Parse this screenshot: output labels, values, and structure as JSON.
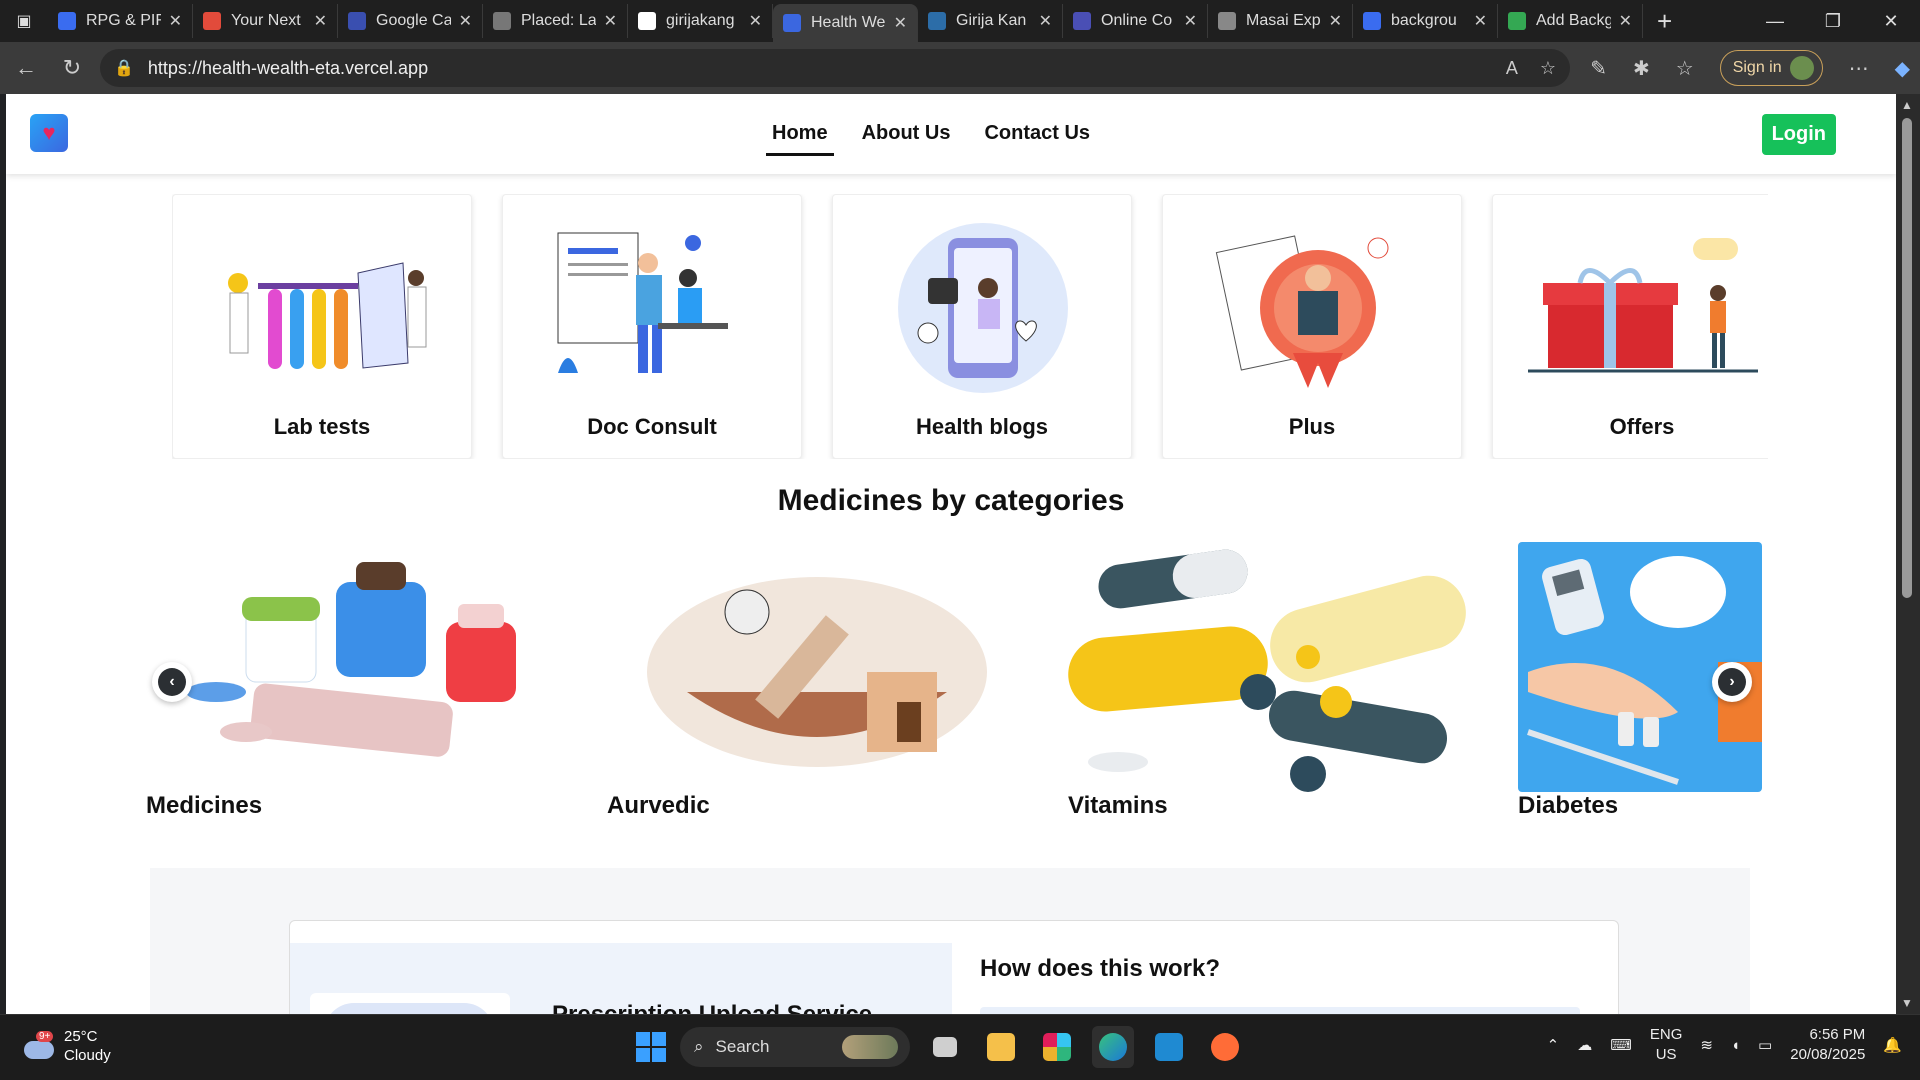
{
  "browser": {
    "tabs": [
      {
        "title": "RPG & PIF",
        "color": "#3a6cf0"
      },
      {
        "title": "Your Next",
        "color": "#e24b3b"
      },
      {
        "title": "Google Ca",
        "color": "#3a4fb0"
      },
      {
        "title": "Placed: La",
        "color": "#777777"
      },
      {
        "title": "girijakang",
        "color": "#ffffff"
      },
      {
        "title": "Health We",
        "color": "#3b67e0"
      },
      {
        "title": "Girija Kan",
        "color": "#2c6da8"
      },
      {
        "title": "Online Co",
        "color": "#4a4fb5"
      },
      {
        "title": "Masai Exp",
        "color": "#888888"
      },
      {
        "title": "backgrou",
        "color": "#3a6cf0"
      },
      {
        "title": "Add Backg",
        "color": "#34a853"
      }
    ],
    "url": "https://health-wealth-eta.vercel.app",
    "signin_label": "Sign in"
  },
  "site": {
    "nav": {
      "home": "Home",
      "about": "About Us",
      "contact": "Contact Us"
    },
    "login_label": "Login",
    "services": [
      "Lab tests",
      "Doc Consult",
      "Health blogs",
      "Plus",
      "Offers"
    ],
    "categories_title": "Medicines by categories",
    "categories": [
      "Medicines",
      "Aurvedic",
      "Vitamins",
      "Diabetes"
    ],
    "prescription_title": "Prescription Upload Service",
    "how_title": "How does this work?"
  },
  "taskbar": {
    "weather_temp": "25°C",
    "weather_desc": "Cloudy",
    "weather_badge": "9+",
    "search_placeholder": "Search",
    "lang_line1": "ENG",
    "lang_line2": "US",
    "time": "6:56 PM",
    "date": "20/08/2025"
  },
  "colors": {
    "accent_green": "#16c15a",
    "brand_blue": "#3b67e0",
    "heart": "#e8265e"
  }
}
